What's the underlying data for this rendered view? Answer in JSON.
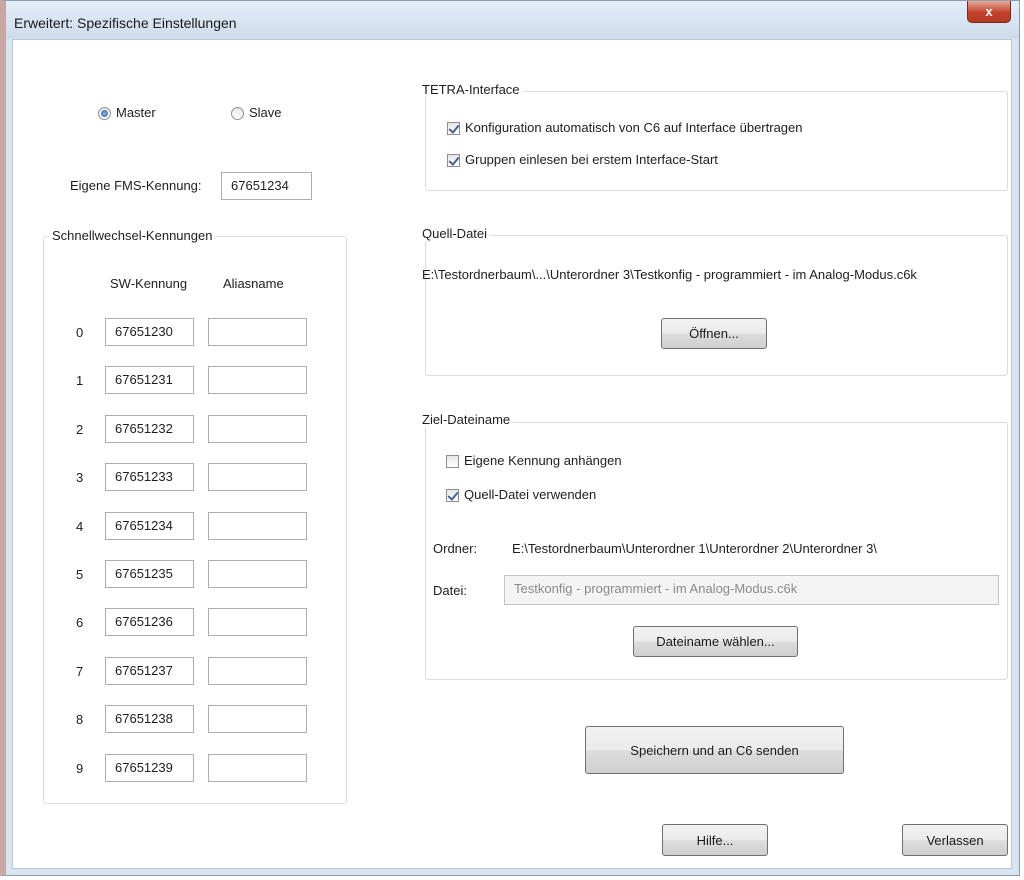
{
  "window": {
    "title": "Erweitert: Spezifische Einstellungen",
    "close_label": "x"
  },
  "mode": {
    "master_label": "Master",
    "slave_label": "Slave",
    "selected": "Master"
  },
  "fms": {
    "label": "Eigene FMS-Kennung:",
    "value": "67651234"
  },
  "schnellwechsel": {
    "title": "Schnellwechsel-Kennungen",
    "col_sw": "SW-Kennung",
    "col_alias": "Aliasname",
    "rows": [
      {
        "index": "0",
        "sw": "67651230",
        "alias": ""
      },
      {
        "index": "1",
        "sw": "67651231",
        "alias": ""
      },
      {
        "index": "2",
        "sw": "67651232",
        "alias": ""
      },
      {
        "index": "3",
        "sw": "67651233",
        "alias": ""
      },
      {
        "index": "4",
        "sw": "67651234",
        "alias": ""
      },
      {
        "index": "5",
        "sw": "67651235",
        "alias": ""
      },
      {
        "index": "6",
        "sw": "67651236",
        "alias": ""
      },
      {
        "index": "7",
        "sw": "67651237",
        "alias": ""
      },
      {
        "index": "8",
        "sw": "67651238",
        "alias": ""
      },
      {
        "index": "9",
        "sw": "67651239",
        "alias": ""
      }
    ]
  },
  "tetra": {
    "title": "TETRA-Interface",
    "auto_transfer_label": "Konfiguration automatisch von C6 auf Interface übertragen",
    "auto_transfer_checked": true,
    "read_groups_label": "Gruppen einlesen bei erstem Interface-Start",
    "read_groups_checked": true
  },
  "quell": {
    "title": "Quell-Datei",
    "path": "E:\\Testordnerbaum\\...\\Unterordner 3\\Testkonfig - programmiert - im Analog-Modus.c6k",
    "open_label": "Öffnen..."
  },
  "ziel": {
    "title": "Ziel-Dateiname",
    "append_id_label": "Eigene Kennung anhängen",
    "append_id_checked": false,
    "use_source_label": "Quell-Datei verwenden",
    "use_source_checked": true,
    "folder_label": "Ordner:",
    "folder_value": "E:\\Testordnerbaum\\Unterordner 1\\Unterordner 2\\Unterordner 3\\",
    "file_label": "Datei:",
    "file_value": "Testkonfig - programmiert - im Analog-Modus.c6k",
    "choose_label": "Dateiname wählen..."
  },
  "actions": {
    "save_send_label": "Speichern und an C6 senden",
    "help_label": "Hilfe...",
    "exit_label": "Verlassen"
  }
}
